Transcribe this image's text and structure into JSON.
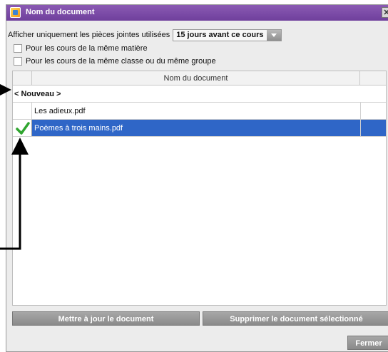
{
  "window": {
    "title": "Nom du document",
    "close_glyph": "✕"
  },
  "filter": {
    "label": "Afficher uniquement les pièces jointes utilisées",
    "selected": "15 jours avant ce cours"
  },
  "options": [
    {
      "label": "Pour les cours de la même matière",
      "checked": false
    },
    {
      "label": "Pour les cours de la même classe ou du même groupe",
      "checked": false
    }
  ],
  "table": {
    "header": "Nom du document",
    "new_row": "< Nouveau >",
    "rows": [
      {
        "name": "Les adieux.pdf",
        "checked": false
      },
      {
        "name": "Poèmes à trois mains.pdf",
        "checked": true,
        "selected": true
      }
    ]
  },
  "buttons": {
    "update": "Mettre à jour le document",
    "delete": "Supprimer le document sélectionné",
    "close": "Fermer"
  },
  "colors": {
    "titlebar": "#7a4aa8",
    "selection": "#2f66c7",
    "button": "#999999"
  },
  "icons": {
    "title": "document-icon",
    "close": "close-icon",
    "dropdown": "chevron-down-icon",
    "row_check": "check-icon"
  }
}
